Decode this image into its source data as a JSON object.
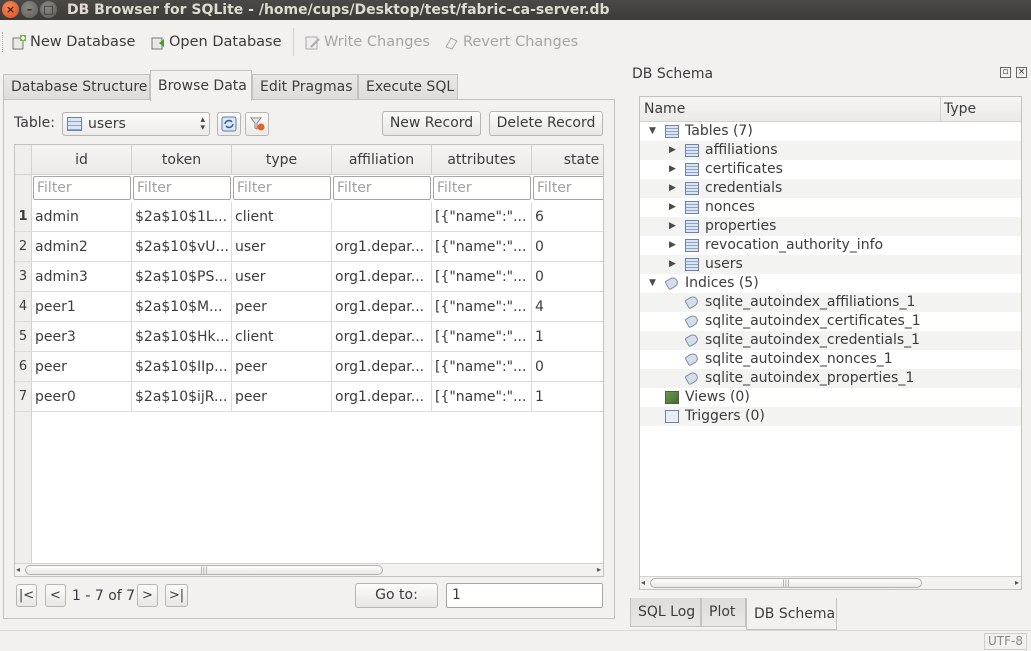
{
  "window": {
    "title": "DB Browser for SQLite - /home/cups/Desktop/test/fabric-ca-server.db"
  },
  "toolbar": {
    "new_database": "New Database",
    "open_database": "Open Database",
    "write_changes": "Write Changes",
    "revert_changes": "Revert Changes"
  },
  "tabs": [
    "Database Structure",
    "Browse Data",
    "Edit Pragmas",
    "Execute SQL"
  ],
  "browse": {
    "table_label": "Table:",
    "table_selected": "users",
    "new_record": "New Record",
    "delete_record": "Delete Record",
    "columns": [
      "id",
      "token",
      "type",
      "affiliation",
      "attributes",
      "state"
    ],
    "filter_placeholder": "Filter",
    "rows": [
      {
        "num": "1",
        "cells": [
          "admin",
          "$2a$10$1L...",
          "client",
          "",
          "[{\"name\":\"...",
          "6"
        ]
      },
      {
        "num": "2",
        "cells": [
          "admin2",
          "$2a$10$vU...",
          "user",
          "org1.depar...",
          "[{\"name\":\"...",
          "0"
        ]
      },
      {
        "num": "3",
        "cells": [
          "admin3",
          "$2a$10$PS...",
          "user",
          "org1.depar...",
          "[{\"name\":\"...",
          "0"
        ]
      },
      {
        "num": "4",
        "cells": [
          "peer1",
          "$2a$10$M...",
          "peer",
          "org1.depar...",
          "[{\"name\":\"...",
          "4"
        ]
      },
      {
        "num": "5",
        "cells": [
          "peer3",
          "$2a$10$Hk...",
          "client",
          "org1.depar...",
          "[{\"name\":\"...",
          "1"
        ]
      },
      {
        "num": "6",
        "cells": [
          "peer",
          "$2a$10$IIp...",
          "peer",
          "org1.depar...",
          "[{\"name\":\"...",
          "0"
        ]
      },
      {
        "num": "7",
        "cells": [
          "peer0",
          "$2a$10$ijR...",
          "peer",
          "org1.depar...",
          "[{\"name\":\"...",
          "1"
        ]
      }
    ],
    "nav": {
      "first": "|<",
      "prev": "<",
      "range": "1 - 7 of 7",
      "next": ">",
      "last": ">|"
    },
    "goto_label": "Go to:",
    "goto_value": "1"
  },
  "schema": {
    "title": "DB Schema",
    "col_name": "Name",
    "col_type": "Type",
    "tables_label": "Tables (7)",
    "tables": [
      "affiliations",
      "certificates",
      "credentials",
      "nonces",
      "properties",
      "revocation_authority_info",
      "users"
    ],
    "indices_label": "Indices (5)",
    "indices": [
      "sqlite_autoindex_affiliations_1",
      "sqlite_autoindex_certificates_1",
      "sqlite_autoindex_credentials_1",
      "sqlite_autoindex_nonces_1",
      "sqlite_autoindex_properties_1"
    ],
    "views_label": "Views (0)",
    "triggers_label": "Triggers (0)"
  },
  "bottom_tabs": [
    "SQL Log",
    "Plot",
    "DB Schema"
  ],
  "status": {
    "encoding": "UTF-8"
  }
}
